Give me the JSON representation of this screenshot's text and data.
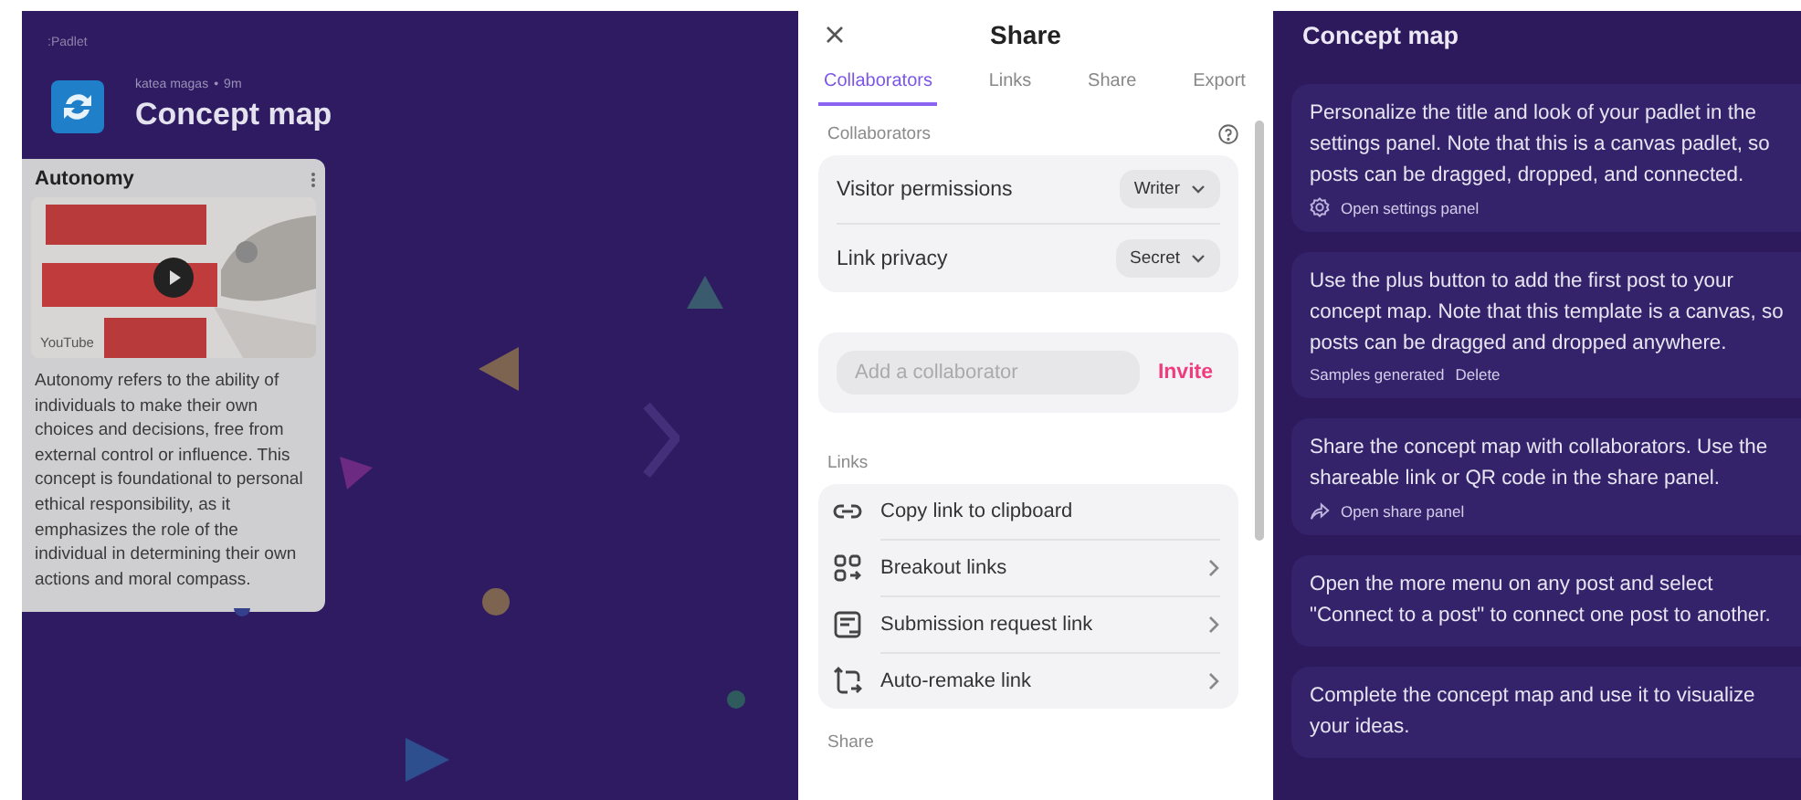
{
  "canvas": {
    "brand": ":Padlet",
    "author": "katea magas",
    "separator": "•",
    "time": "9m",
    "title": "Concept map",
    "post": {
      "title": "Autonomy",
      "source": "YouTube",
      "body": "Autonomy refers to the ability of individuals to make their own choices and decisions, free from external control or influence. This concept is foundational to personal ethical responsibility, as it emphasizes the role of the individual in determining their own actions and moral compass."
    }
  },
  "share_panel": {
    "title": "Share",
    "tabs": [
      {
        "label": "Collaborators",
        "selected": true
      },
      {
        "label": "Links",
        "selected": false
      },
      {
        "label": "Share",
        "selected": false
      },
      {
        "label": "Export",
        "selected": false
      }
    ],
    "collaborators": {
      "heading": "Collaborators",
      "settings": [
        {
          "label": "Visitor permissions",
          "value": "Writer"
        },
        {
          "label": "Link privacy",
          "value": "Secret"
        }
      ],
      "invite": {
        "placeholder": "Add a collaborator",
        "button": "Invite"
      }
    },
    "links": {
      "heading": "Links",
      "items": [
        {
          "label": "Copy link to clipboard",
          "kind": "action"
        },
        {
          "label": "Breakout links",
          "kind": "submenu"
        },
        {
          "label": "Submission request link",
          "kind": "submenu"
        },
        {
          "label": "Auto-remake link",
          "kind": "submenu"
        }
      ]
    },
    "next_heading": "Share"
  },
  "guide": {
    "title": "Concept map",
    "cards": [
      {
        "text": "Personalize the title and look of your padlet in the settings panel. Note that this is a canvas padlet, so posts can be dragged, dropped, and connected.",
        "kind": "action",
        "action": "Open settings panel"
      },
      {
        "text": "Use the plus button to add the first post to your concept map. Note that this template is a canvas, so posts can be dragged and dropped anywhere.",
        "kind": "meta",
        "note": "Samples generated",
        "action": "Delete"
      },
      {
        "text": "Share the concept map with collaborators. Use the shareable link or QR code in the share panel.",
        "kind": "action",
        "action": "Open share panel"
      },
      {
        "text": "Open the more menu on any post and select \"Connect to a post\" to connect one post to another.",
        "kind": "plain"
      },
      {
        "text": "Complete the concept map and use it to visualize your ideas.",
        "kind": "plain"
      }
    ]
  }
}
